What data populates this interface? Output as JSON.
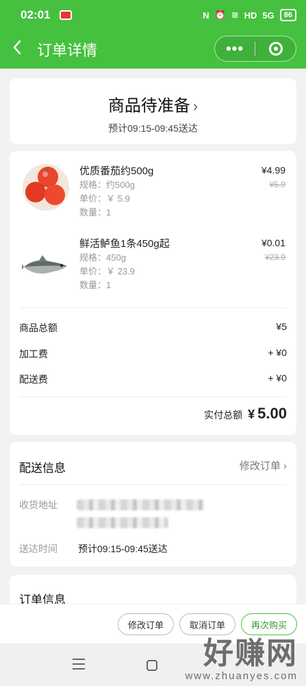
{
  "status_bar": {
    "time": "02:01",
    "right": {
      "nfc": "N",
      "alarm": "⏰",
      "wifi": "≋",
      "hd": "HD",
      "signal": "5G",
      "battery": "86"
    }
  },
  "nav": {
    "title": "订单详情",
    "back_icon": "chevron-left-icon",
    "more_label": "•••"
  },
  "order_status": {
    "title": "商品待准备",
    "eta": "预计09:15-09:45送达"
  },
  "items": [
    {
      "name": "优质番茄约500g",
      "spec": "规格：约500g",
      "unit_price": "单价：￥ 5.9",
      "qty": "数量：1",
      "price": "¥4.99",
      "original_price": "¥5.9",
      "image": "tomato"
    },
    {
      "name": "鲜活鲈鱼1条450g起",
      "spec": "规格：450g",
      "unit_price": "单价：￥ 23.9",
      "qty": "数量：1",
      "price": "¥0.01",
      "original_price": "¥23.9",
      "image": "fish"
    }
  ],
  "fees": [
    {
      "label": "商品总额",
      "value": "¥5"
    },
    {
      "label": "加工费",
      "value": "+ ¥0"
    },
    {
      "label": "配送费",
      "value": "+ ¥0"
    }
  ],
  "total": {
    "label": "实付总额",
    "currency": "¥",
    "amount": "5.00"
  },
  "delivery": {
    "title": "配送信息",
    "modify_link": "修改订单 ›",
    "address_label": "收货地址",
    "time_label": "送达时间",
    "time_value": "预计09:15-09:45送达"
  },
  "order_info": {
    "title": "订单信息"
  },
  "actions": {
    "modify": "修改订单",
    "cancel": "取消订单",
    "reorder": "再次购买"
  },
  "watermark": {
    "big": "好赚网",
    "small": "www.zhuanyes.com"
  },
  "colors": {
    "brand_green": "#45c13f"
  }
}
